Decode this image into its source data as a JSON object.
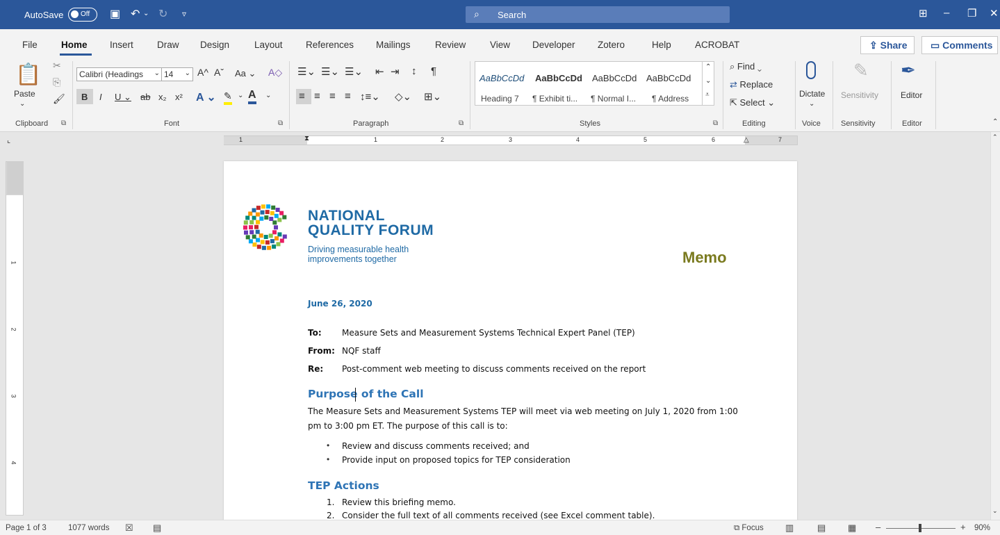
{
  "titlebar": {
    "autosave_label": "AutoSave",
    "autosave_state": "Off",
    "search_placeholder": "Search"
  },
  "tabs": [
    "File",
    "Home",
    "Insert",
    "Draw",
    "Design",
    "Layout",
    "References",
    "Mailings",
    "Review",
    "View",
    "Developer",
    "Zotero",
    "Help",
    "ACROBAT"
  ],
  "active_tab": "Home",
  "share_label": "Share",
  "comments_label": "Comments",
  "ribbon": {
    "clipboard": {
      "paste": "Paste",
      "label": "Clipboard"
    },
    "font": {
      "name": "Calibri (Headings",
      "size": "14",
      "label": "Font"
    },
    "paragraph": {
      "label": "Paragraph"
    },
    "styles": {
      "samples": [
        {
          "sample": "AaBbCcDd",
          "name": "Heading 7"
        },
        {
          "sample": "AaBbCcDd",
          "name": "¶ Exhibit ti..."
        },
        {
          "sample": "AaBbCcDd",
          "name": "¶ Normal I..."
        },
        {
          "sample": "AaBbCcDd",
          "name": "¶ Address"
        }
      ],
      "label": "Styles"
    },
    "editing": {
      "find": "Find",
      "replace": "Replace",
      "select": "Select",
      "label": "Editing"
    },
    "voice": {
      "dictate": "Dictate",
      "label": "Voice"
    },
    "sensitivity": {
      "button": "Sensitivity",
      "label": "Sensitivity"
    },
    "editor": {
      "button": "Editor",
      "label": "Editor"
    }
  },
  "ruler_numbers": [
    "1",
    "1",
    "2",
    "3",
    "4",
    "5",
    "6",
    "7"
  ],
  "vruler_numbers": [
    "1",
    "2",
    "3",
    "4"
  ],
  "document": {
    "logo_line1": "NATIONAL",
    "logo_line2": "QUALITY FORUM",
    "logo_tag1": "Driving measurable health",
    "logo_tag2": "improvements together",
    "memo": "Memo",
    "date": "June 26, 2020",
    "to_label": "To:",
    "to_value": "Measure Sets and Measurement Systems Technical Expert Panel (TEP)",
    "from_label": "From:",
    "from_value": "NQF staff",
    "re_label": "Re:",
    "re_value": "Post-comment web meeting to discuss comments received on the report",
    "heading1": "Purpose of the Call",
    "para1_line1": "The Measure Sets and Measurement Systems TEP will meet via web meeting on July 1, 2020 from 1:00",
    "para1_line2": "pm to 3:00 pm ET. The purpose of this call is to:",
    "bullets": [
      "Review and discuss comments received; and",
      "Provide input on proposed topics for TEP consideration"
    ],
    "heading2": "TEP Actions",
    "numbered": [
      "Review this briefing memo.",
      "Consider the full text of all comments received (see Excel comment table)."
    ]
  },
  "status": {
    "page": "Page 1 of 3",
    "words": "1077 words",
    "focus": "Focus",
    "zoom": "90%"
  },
  "colors": {
    "titlebar": "#2b579a",
    "heading": "#2e74b5",
    "memo": "#7a7a1f",
    "logo": "#1f6aa5"
  }
}
